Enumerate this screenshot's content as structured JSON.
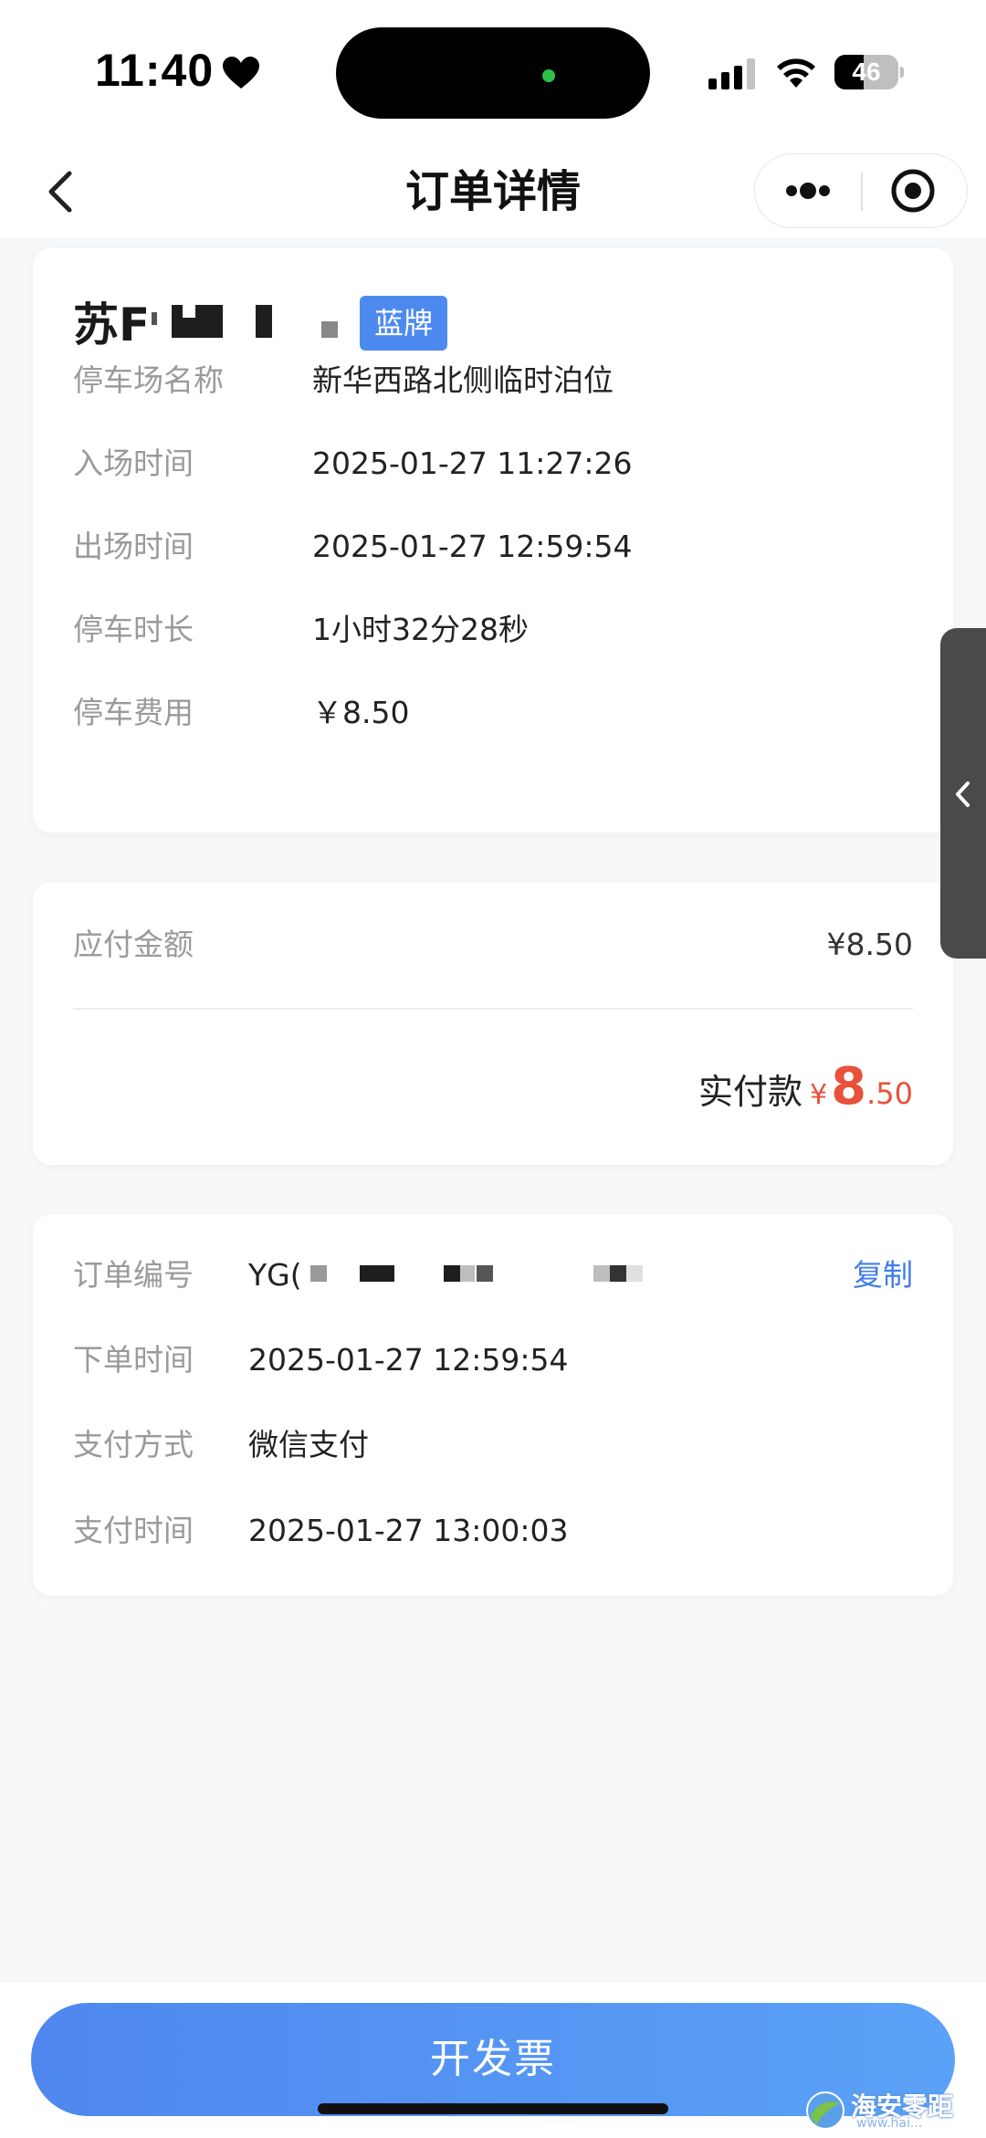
{
  "status_bar": {
    "time": "11:40",
    "battery": "46",
    "battery_level": 0.46,
    "icons": [
      "heart-icon",
      "signal-icon",
      "wifi-icon",
      "battery-icon"
    ]
  },
  "nav": {
    "title": "订单详情",
    "icons": [
      "back-arrow-icon",
      "more-dots-icon",
      "target-circle-icon"
    ]
  },
  "car_card": {
    "plate_prefix": "苏F",
    "plate_type": "蓝牌",
    "rows": [
      {
        "label": "停车场名称",
        "value": "新华西路北侧临时泊位"
      },
      {
        "label": "入场时间",
        "value": "2025-01-27 11:27:26"
      },
      {
        "label": "出场时间",
        "value": "2025-01-27 12:59:54"
      },
      {
        "label": "停车时长",
        "value": "1小时32分28秒"
      },
      {
        "label": "停车费用",
        "value": "￥8.50"
      }
    ]
  },
  "payment_card": {
    "due_label": "应付金额",
    "due_value": "¥8.50",
    "actual_label": "实付款",
    "actual_currency": "¥",
    "actual_integer": "8",
    "actual_decimal": ".50"
  },
  "order_card": {
    "order_no_label": "订单编号",
    "order_no_value": "YG(",
    "copy_label": "复制",
    "rows": [
      {
        "label": "下单时间",
        "value": "2025-01-27 12:59:54"
      },
      {
        "label": "支付方式",
        "value": "微信支付"
      },
      {
        "label": "支付时间",
        "value": "2025-01-27 13:00:03"
      }
    ]
  },
  "footer": {
    "invoice_label": "开发票"
  },
  "watermark": {
    "text": "海安零距",
    "sub": "www.hai..."
  },
  "colors": {
    "accent_blue": "#4d8af0",
    "price_red": "#e8513a",
    "link_blue": "#3f7ee8",
    "button_gradient_start": "#4f87ef",
    "button_gradient_end": "#5aa2f7"
  }
}
